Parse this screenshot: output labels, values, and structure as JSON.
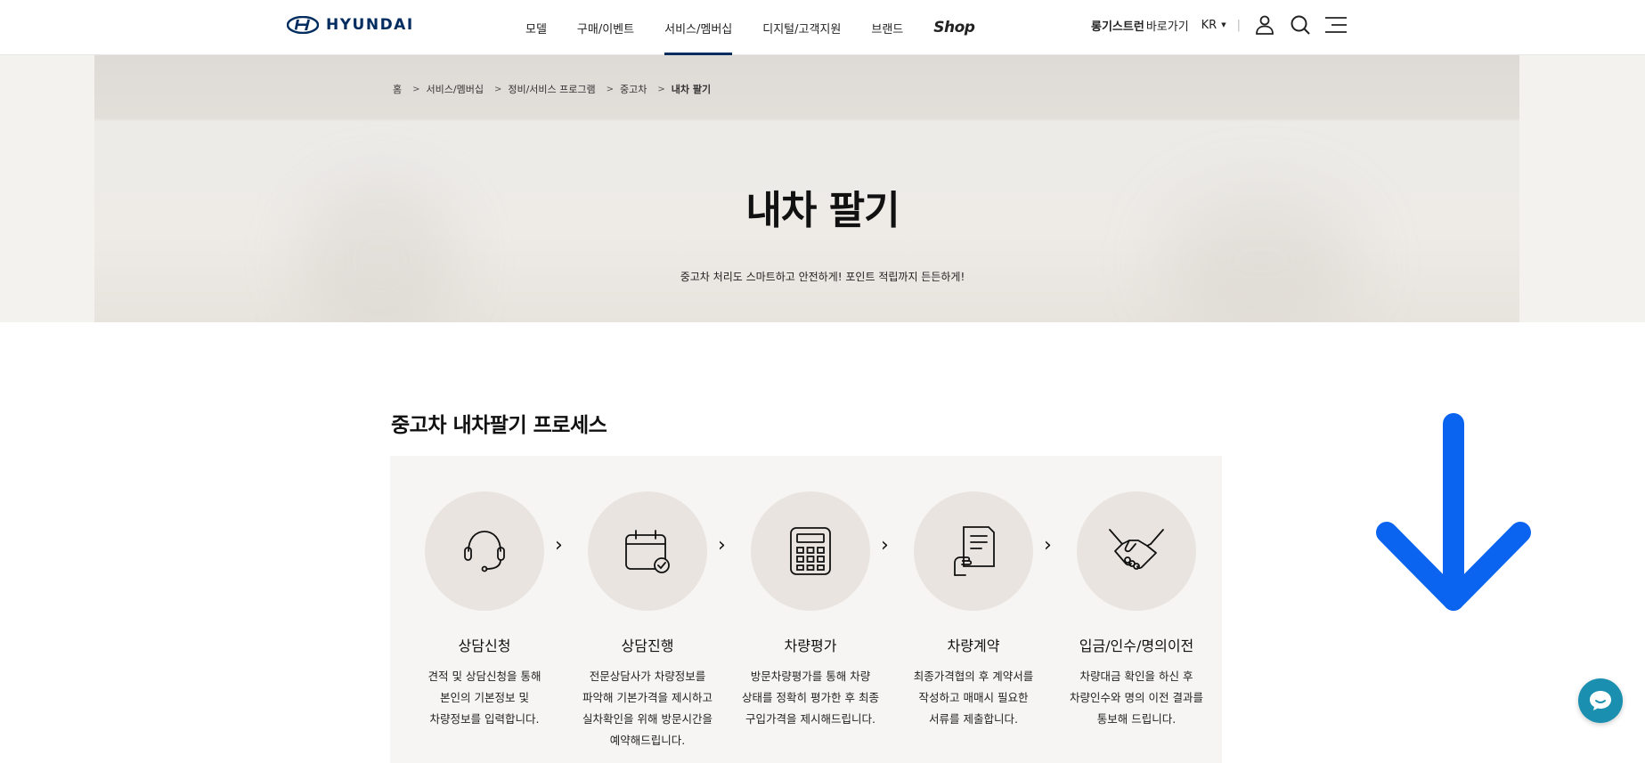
{
  "header": {
    "logo_text": "HYUNDAI",
    "nav": [
      "모델",
      "구매/이벤트",
      "서비스/멤버십",
      "디지털/고객지원",
      "브랜드"
    ],
    "nav_active_index": 2,
    "shop_label": "Shop",
    "util": {
      "long_label": "롱기스트런",
      "goto_label": "바로가기",
      "lang": "KR"
    },
    "icons": [
      "user-icon",
      "search-icon",
      "menu-icon"
    ]
  },
  "breadcrumb": [
    "홈",
    "서비스/멤버십",
    "정비/서비스 프로그램",
    "중고차",
    "내차 팔기"
  ],
  "hero": {
    "title": "내차 팔기",
    "subtitle": "중고차 처리도 스마트하고 안전하게! 포인트 적립까지 든든하게!"
  },
  "process": {
    "title": "중고차 내차팔기 프로세스",
    "steps": [
      {
        "name": "상담신청",
        "desc": "견적 및 상담신청을 통해\n본인의 기본정보 및\n차량정보를 입력합니다.",
        "icon": "headset-icon"
      },
      {
        "name": "상담진행",
        "desc": "전문상담사가 차량정보를\n파악해 기본가격을 제시하고\n실차확인을 위해 방문시간을\n예약해드립니다.",
        "icon": "calendar-check-icon"
      },
      {
        "name": "차량평가",
        "desc": "방문차량평가를 통해 차량\n상태를 정확히 평가한 후 최종\n구입가격을 제시해드립니다.",
        "icon": "calculator-icon"
      },
      {
        "name": "차량계약",
        "desc": "최종가격협의 후 계약서를\n작성하고 매매시 필요한\n서류를 제출합니다.",
        "icon": "document-hand-icon"
      },
      {
        "name": "입금/인수/명의이전",
        "desc": "차량대금 확인을 하신 후\n차량인수와 명의 이전 결과를\n통보해 드립니다.",
        "icon": "handshake-icon"
      }
    ]
  },
  "colors": {
    "brand": "#002c5f",
    "scroll_arrow": "#0a64f0",
    "chat": "#1a8fb0"
  }
}
